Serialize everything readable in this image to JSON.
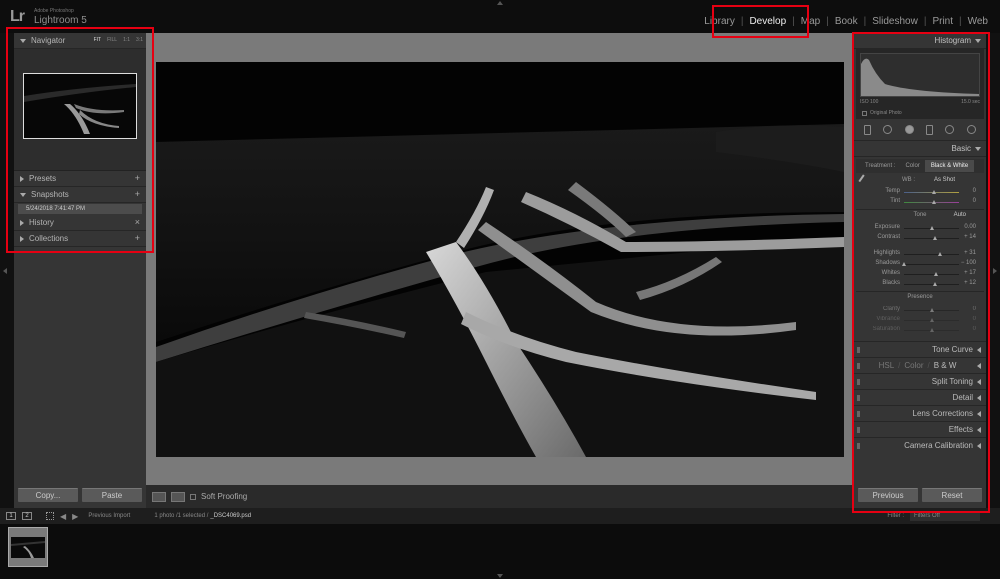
{
  "app": {
    "logo_mark": "Lr",
    "vendor": "Adobe Photoshop",
    "product": "Lightroom 5"
  },
  "modules": [
    {
      "label": "Library"
    },
    {
      "label": "Develop",
      "active": true
    },
    {
      "label": "Map"
    },
    {
      "label": "Book"
    },
    {
      "label": "Slideshow"
    },
    {
      "label": "Print"
    },
    {
      "label": "Web"
    }
  ],
  "left_panel": {
    "navigator": {
      "title": "Navigator",
      "zoom_options": [
        "FIT",
        "FILL",
        "1:1",
        "3:1"
      ],
      "active_zoom": "FIT"
    },
    "presets": {
      "title": "Presets"
    },
    "snapshots": {
      "title": "Snapshots",
      "items": [
        "5/24/2018 7:41:47 PM"
      ]
    },
    "history": {
      "title": "History"
    },
    "collections": {
      "title": "Collections"
    },
    "copy_label": "Copy...",
    "paste_label": "Paste"
  },
  "toolbar": {
    "soft_proofing_label": "Soft Proofing"
  },
  "right_panel": {
    "histogram": {
      "title": "Histogram",
      "iso": "ISO 100",
      "shutter": "15.0 sec",
      "original_photo": "Original Photo"
    },
    "basic": {
      "title": "Basic",
      "treatment_label": "Treatment :",
      "treatment_color": "Color",
      "treatment_bw": "Black & White",
      "wb_label": "WB :",
      "wb_value": "As Shot",
      "temp": {
        "label": "Temp",
        "value": "0",
        "level": 0.55
      },
      "tint": {
        "label": "Tint",
        "value": "0",
        "level": 0.55
      },
      "tone_label": "Tone",
      "auto_label": "Auto",
      "exposure": {
        "label": "Exposure",
        "value": "0.00",
        "level": 0.5
      },
      "contrast": {
        "label": "Contrast",
        "value": "+ 14",
        "level": 0.57
      },
      "highlights": {
        "label": "Highlights",
        "value": "+ 31",
        "level": 0.65
      },
      "shadows": {
        "label": "Shadows",
        "value": "− 100",
        "level": 0.0
      },
      "whites": {
        "label": "Whites",
        "value": "+ 17",
        "level": 0.58
      },
      "blacks": {
        "label": "Blacks",
        "value": "+ 12",
        "level": 0.56
      },
      "presence_label": "Presence",
      "clarity": {
        "label": "Clarity",
        "value": "0",
        "level": 0.5
      },
      "vibrance": {
        "label": "Vibrance",
        "value": "0",
        "level": 0.5
      },
      "saturation": {
        "label": "Saturation",
        "value": "0",
        "level": 0.5
      }
    },
    "tone_curve": "Tone Curve",
    "hsl": {
      "hsl": "HSL",
      "color": "Color",
      "bw": "B & W"
    },
    "split_toning": "Split Toning",
    "detail": "Detail",
    "lens_corrections": "Lens Corrections",
    "effects": "Effects",
    "camera_calibration": "Camera Calibration",
    "previous_label": "Previous",
    "reset_label": "Reset"
  },
  "filmstrip": {
    "screen1": "1",
    "screen2": "2",
    "source": "Previous Import",
    "selection": "1 photo /1 selected /",
    "filename": "_DSC4069.psd",
    "filter_label": "Filter :",
    "filter_value": "Filters Off"
  },
  "colors": {
    "highlight": "#e60012",
    "panel": "#353535",
    "background": "#111111"
  }
}
